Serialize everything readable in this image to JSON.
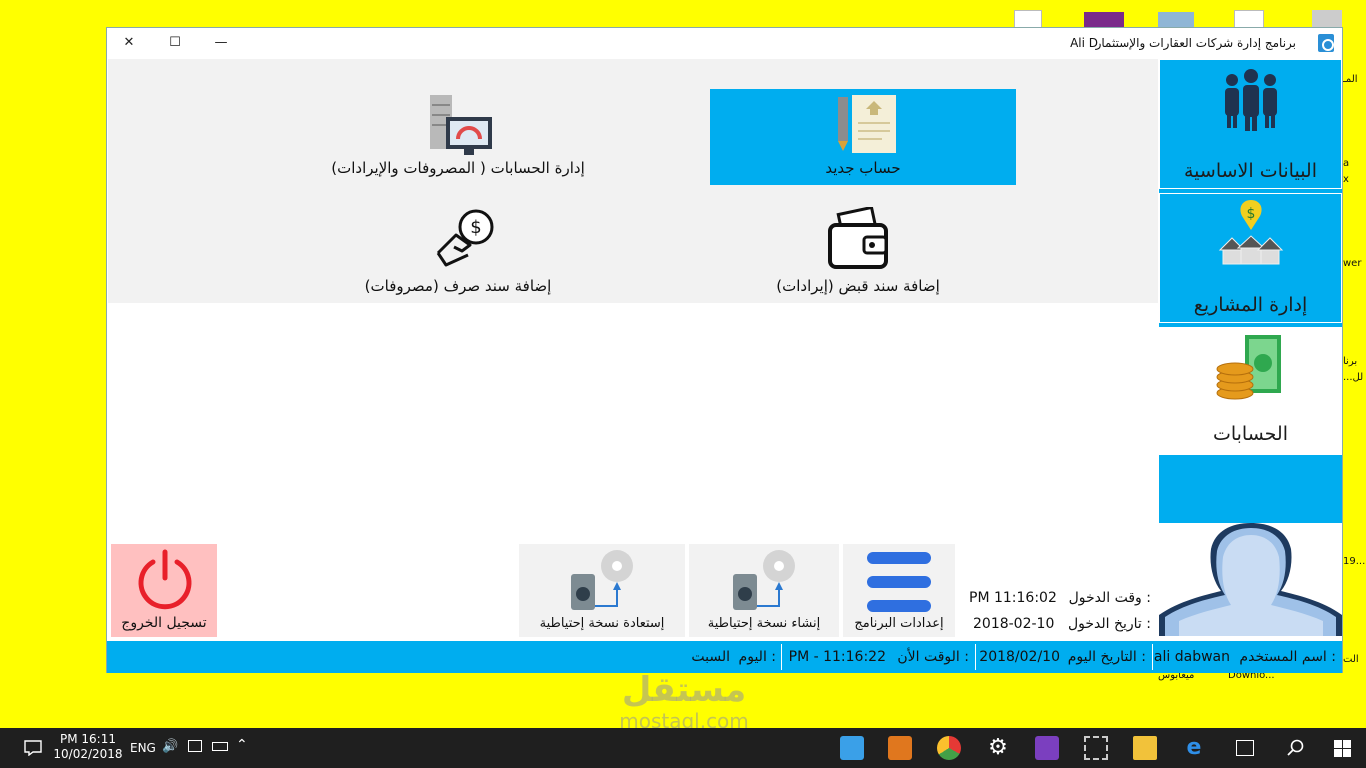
{
  "window": {
    "title": "برنامج إدارة شركات العقارات والإستثمار",
    "user_short": "Ali D",
    "minimize": "—",
    "maximize": "☐",
    "close": "✕"
  },
  "sidebar": {
    "items": [
      {
        "label": "البيانات الاساسية",
        "icon": "people-group-icon"
      },
      {
        "label": "إدارة المشاريع",
        "icon": "houses-dollar-icon"
      },
      {
        "label": "الحسابات",
        "icon": "coins-banknote-icon"
      }
    ]
  },
  "panel": {
    "tiles": [
      {
        "label": "حساب جديد",
        "icon": "document-pen-icon"
      },
      {
        "label": "إدارة الحسابات ( المصروفات والإيرادات)",
        "icon": "server-monitor-icon"
      },
      {
        "label": "إضافة سند قبض (إيرادات)",
        "icon": "wallet-icon"
      },
      {
        "label": "إضافة سند صرف (مصروفات)",
        "icon": "hand-coin-icon"
      }
    ]
  },
  "bottom": {
    "logout": "تسجيل الخروج",
    "restore_backup": "إستعادة نسخة إحتياطية",
    "create_backup": "إنشاء نسخة إحتياطية",
    "settings": "إعدادات البرنامج",
    "login_time_label": "وقت الدخول  :",
    "login_time_value": "PM 11:16:02",
    "login_date_label": "تاريخ الدخول  :",
    "login_date_value": "2018-02-10"
  },
  "status": {
    "user_label": "اسم المستخدم  :",
    "user_value": "ali dabwan",
    "date_label": "التاريخ اليوم  :",
    "date_value": "2018/02/10",
    "time_label": "الوقت الأن  :",
    "time_value": "PM - 11:16:22",
    "day_label": "اليوم  :",
    "day_value": "السبت"
  },
  "desktop": {
    "side_labels": [
      "المـ",
      "a",
      "x",
      "wer",
      "برنا",
      "...لل",
      "19...",
      "الت"
    ],
    "bottom_labels": [
      "ميغابوس",
      "Downlo..."
    ]
  },
  "taskbar": {
    "time": "PM 16:11",
    "date": "10/02/2018",
    "lang": "ENG"
  },
  "watermark": {
    "arabic": "مستقل",
    "latin": "mostaql.com"
  },
  "colors": {
    "accent": "#00adef",
    "desktop": "#ffff00",
    "logout_bg": "#ffc0c0",
    "power_red": "#e8202a"
  }
}
